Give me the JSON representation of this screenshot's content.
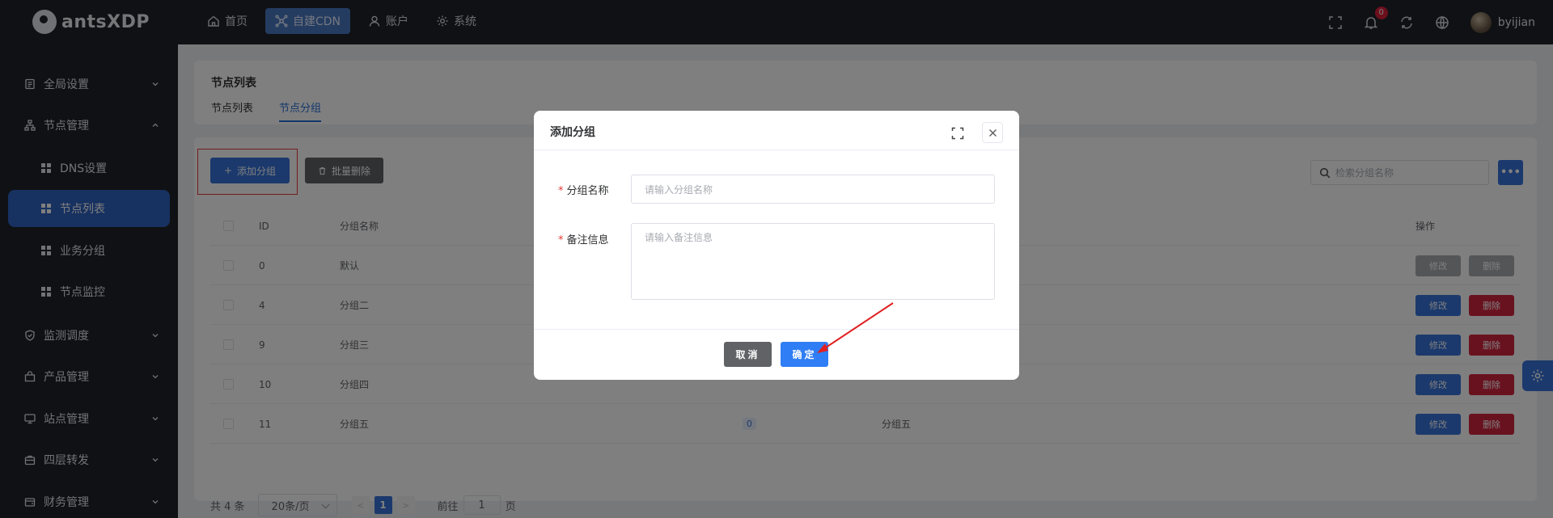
{
  "app": {
    "logo_text": "antsXDP"
  },
  "topnav": [
    {
      "label": "首页",
      "icon": "home-icon"
    },
    {
      "label": "自建CDN",
      "icon": "network-icon",
      "active": true
    },
    {
      "label": "账户",
      "icon": "user-icon"
    },
    {
      "label": "系统",
      "icon": "gear-icon"
    }
  ],
  "notifications": {
    "count": "0"
  },
  "user": {
    "name": "byijian"
  },
  "sidebar": {
    "items": [
      {
        "label": "全局设置"
      },
      {
        "label": "节点管理"
      },
      {
        "label": "DNS设置"
      },
      {
        "label": "节点列表"
      },
      {
        "label": "业务分组"
      },
      {
        "label": "节点监控"
      },
      {
        "label": "监测调度"
      },
      {
        "label": "产品管理"
      },
      {
        "label": "站点管理"
      },
      {
        "label": "四层转发"
      },
      {
        "label": "财务管理"
      }
    ]
  },
  "page": {
    "title": "节点列表",
    "tabs": [
      {
        "label": "节点列表"
      },
      {
        "label": "节点分组"
      }
    ]
  },
  "toolbar": {
    "add_group": "添加分组",
    "batch_delete": "批量删除",
    "search_placeholder": "检索分组名称",
    "more": "•••"
  },
  "table": {
    "headers": {
      "id": "ID",
      "name": "分组名称",
      "actions": "操作"
    },
    "rows": [
      {
        "id": "0",
        "name": "默认",
        "count": "",
        "remark": ""
      },
      {
        "id": "4",
        "name": "分组二",
        "count": "",
        "remark": ""
      },
      {
        "id": "9",
        "name": "分组三",
        "count": "",
        "remark": ""
      },
      {
        "id": "10",
        "name": "分组四",
        "count": "",
        "remark": ""
      },
      {
        "id": "11",
        "name": "分组五",
        "count": "0",
        "remark": "分组五"
      }
    ],
    "edit_label": "修改",
    "delete_label": "删除"
  },
  "pager": {
    "total": "共 4 条",
    "page_size": "20条/页",
    "prev": "<",
    "current": "1",
    "next": ">",
    "goto_prefix": "前往",
    "goto_value": "1",
    "goto_suffix": "页"
  },
  "dialog": {
    "title": "添加分组",
    "name_label": "分组名称",
    "name_placeholder": "请输入分组名称",
    "remark_label": "备注信息",
    "remark_placeholder": "请输入备注信息",
    "required_mark": "*",
    "cancel": "取消",
    "confirm": "确定"
  }
}
